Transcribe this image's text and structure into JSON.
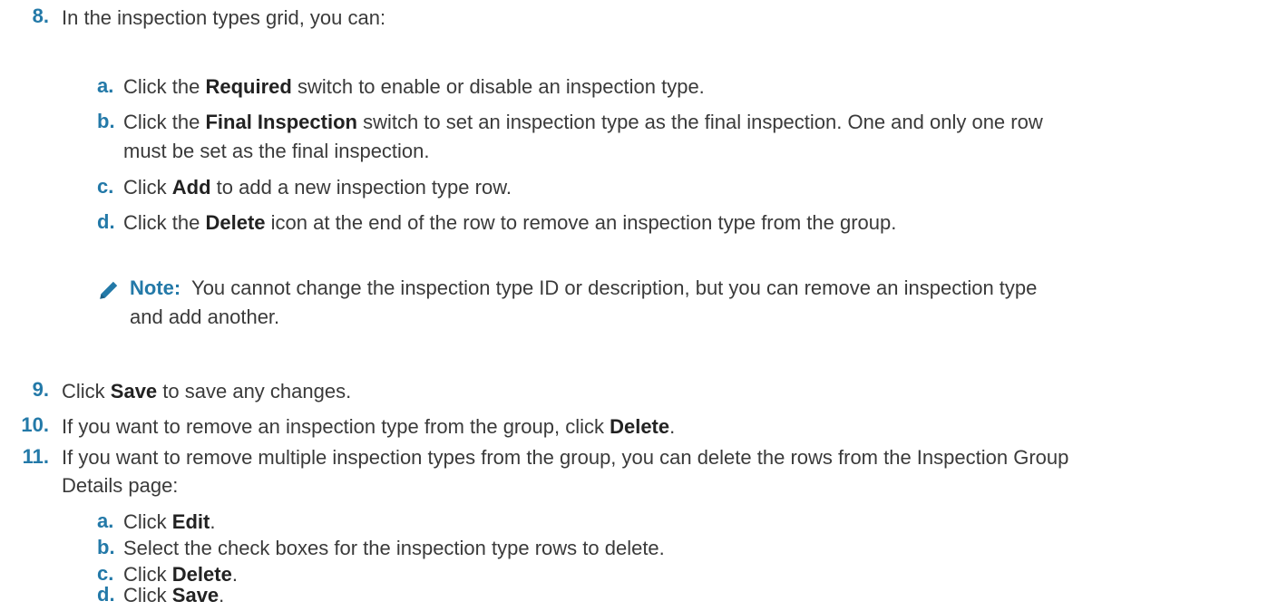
{
  "steps": {
    "s8": {
      "num": "8.",
      "text": "In the inspection types grid, you can:",
      "subs": {
        "a": {
          "letter": "a.",
          "pre": "Click the ",
          "bold": "Required",
          "post": " switch to enable or disable an inspection type."
        },
        "b": {
          "letter": "b.",
          "pre": "Click the ",
          "bold": "Final Inspection",
          "post": " switch to set an inspection type as the final inspection. One and only one row",
          "line2": "must be set as the final inspection."
        },
        "c": {
          "letter": "c.",
          "pre": "Click ",
          "bold": "Add",
          "post": " to add a new inspection type row."
        },
        "d": {
          "letter": "d.",
          "pre": "Click the ",
          "bold": "Delete",
          "post": " icon at the end of the row to remove an inspection type from the group."
        }
      },
      "note": {
        "label": "Note:",
        "line1": "You cannot change the inspection type ID or description, but you can remove an inspection type",
        "line2": "and add another."
      }
    },
    "s9": {
      "num": "9.",
      "pre": "Click ",
      "bold": "Save",
      "post": " to save any changes."
    },
    "s10": {
      "num": "10.",
      "pre": "If you want to remove an inspection type from the group, click ",
      "bold": "Delete",
      "post": "."
    },
    "s11": {
      "num": "11.",
      "line1": "If you want to remove multiple inspection types from the group, you can delete the rows from the Inspection Group",
      "line2": "Details page:",
      "subs": {
        "a": {
          "letter": "a.",
          "pre": "Click ",
          "bold": "Edit",
          "post": "."
        },
        "b": {
          "letter": "b.",
          "text": "Select the check boxes for the inspection type rows to delete."
        },
        "c": {
          "letter": "c.",
          "pre": "Click ",
          "bold": "Delete",
          "post": "."
        },
        "d": {
          "letter": "d.",
          "pre": "Click ",
          "bold": "Save",
          "post": "."
        }
      }
    }
  },
  "icons": {
    "note": "pencil-icon"
  },
  "colors": {
    "accent": "#2379a8",
    "text": "#3a3a3a"
  }
}
